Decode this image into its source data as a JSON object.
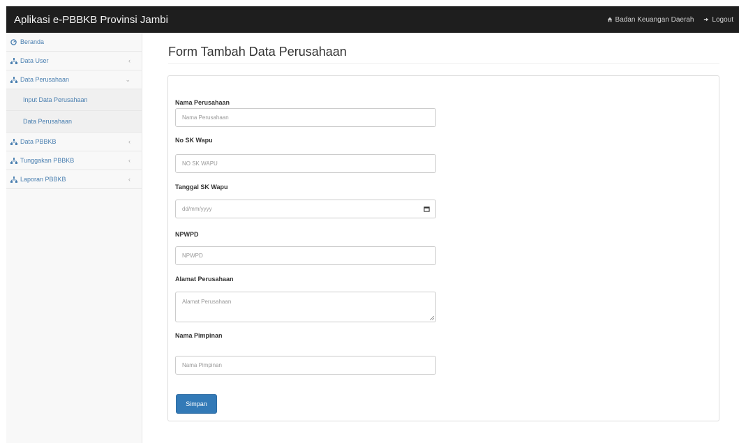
{
  "app": {
    "title": "Aplikasi e-PBBKB Provinsi Jambi",
    "user_label": "Badan Keuangan Daerah",
    "logout_label": "Logout"
  },
  "sidebar": {
    "items": [
      {
        "label": "Beranda",
        "icon": "dashboard-icon",
        "has_arrow": false
      },
      {
        "label": "Data User",
        "icon": "sitemap-icon",
        "has_arrow": true
      },
      {
        "label": "Data Perusahaan",
        "icon": "sitemap-icon",
        "has_arrow": true,
        "expanded": true
      },
      {
        "label": "Data PBBKB",
        "icon": "sitemap-icon",
        "has_arrow": true
      },
      {
        "label": "Tunggakan PBBKB",
        "icon": "sitemap-icon",
        "has_arrow": true
      },
      {
        "label": "Laporan PBBKB",
        "icon": "sitemap-icon",
        "has_arrow": true
      }
    ],
    "subitems": [
      {
        "label": "Input Data Perusahaan"
      },
      {
        "label": "Data Perusahaan"
      }
    ],
    "arrow": "‹"
  },
  "page": {
    "title": "Form Tambah Data Perusahaan"
  },
  "form": {
    "fields": [
      {
        "label": "Nama Perusahaan",
        "placeholder": "Nama Perusahaan",
        "type": "text"
      },
      {
        "label": "No SK Wapu",
        "placeholder": "NO SK WAPU",
        "type": "text"
      },
      {
        "label": "Tanggal SK Wapu",
        "placeholder": "dd/mm/yyyy",
        "type": "date"
      },
      {
        "label": "NPWPD",
        "placeholder": "NPWPD",
        "type": "text"
      },
      {
        "label": "Alamat Perusahaan",
        "placeholder": "Alamat Perusahaan",
        "type": "textarea"
      },
      {
        "label": "Nama Pimpinan",
        "placeholder": "Nama Pimpinan",
        "type": "text"
      }
    ],
    "submit_label": "Simpan"
  },
  "colors": {
    "topbar": "#1e1e1e",
    "link": "#4a7fb0",
    "primary_button": "#337ab7"
  }
}
